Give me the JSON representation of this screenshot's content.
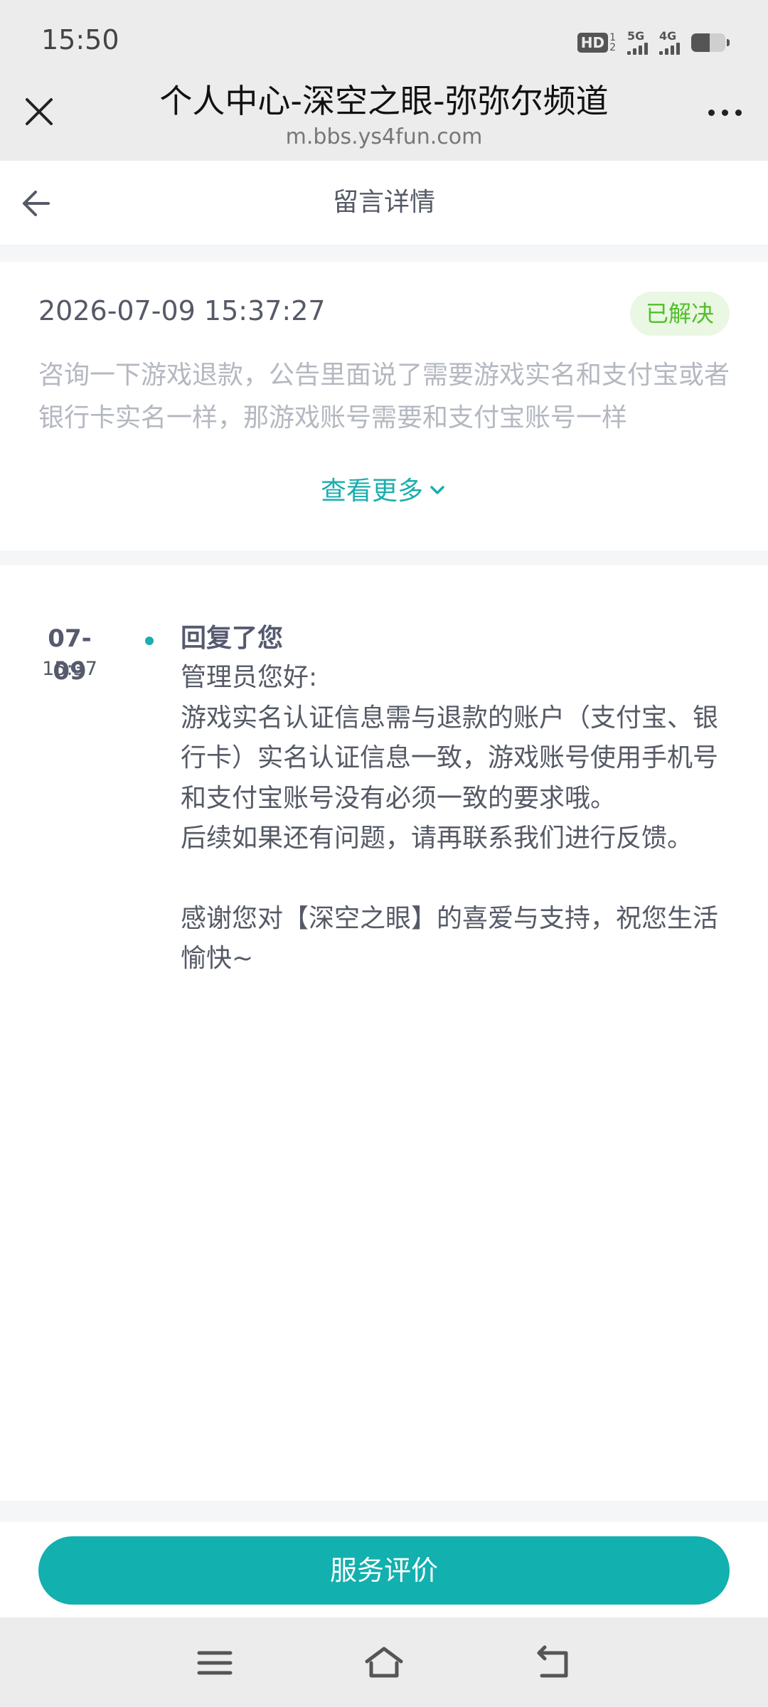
{
  "status_bar": {
    "time": "15:50",
    "hd_label": "HD",
    "hd_sub1": "1",
    "hd_sub2": "2",
    "net1_label": "5G",
    "net2_label": "4G",
    "battery_level": 0.55
  },
  "browser": {
    "title": "个人中心-深空之眼-弥弥尔频道",
    "url": "m.bbs.ys4fun.com",
    "close_icon": "close-icon",
    "more_icon": "more-dots-icon"
  },
  "header": {
    "title": "留言详情",
    "back_icon": "back-arrow-icon"
  },
  "message": {
    "datetime": "2026-07-09 15:37:27",
    "status": "已解决",
    "content": "咨询一下游戏退款，公告里面说了需要游戏实名和支付宝或者银行卡实名一样，那游戏账号需要和支付宝账号一样",
    "see_more": "查看更多"
  },
  "reply": {
    "date": "07-09",
    "time": "15:37",
    "title": "回复了您",
    "greeting": "管理员您好:",
    "line1": "游戏实名认证信息需与退款的账户（支付宝、银行卡）实名认证信息一致，游戏账号使用手机号和支付宝账号没有必须一致的要求哦。",
    "line2": "后续如果还有问题，请再联系我们进行反馈。",
    "line3": "感谢您对【深空之眼】的喜爱与支持，祝您生活愉快~"
  },
  "footer": {
    "rate_label": "服务评价"
  },
  "colors": {
    "accent": "#12b0ae",
    "resolved_text": "#52bf2c",
    "resolved_bg": "#eaf7e3"
  }
}
